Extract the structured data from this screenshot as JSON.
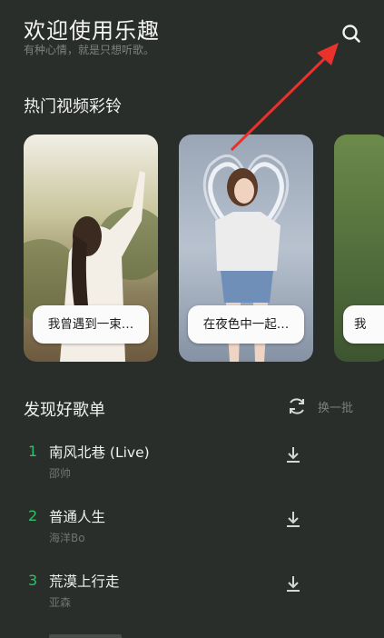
{
  "header": {
    "title": "欢迎使用乐趣",
    "subtitle": "有种心情，就是只想听歌。"
  },
  "video_section": {
    "title": "热门视频彩铃",
    "cards": [
      {
        "caption": "我曾遇到一束…"
      },
      {
        "caption": "在夜色中一起…"
      },
      {
        "caption": "我"
      }
    ]
  },
  "playlist_section": {
    "title": "发现好歌单",
    "refresh_label": "换一批",
    "songs": [
      {
        "index": "1",
        "title": "南风北巷 (Live)",
        "artist": "邵帅"
      },
      {
        "index": "2",
        "title": "普通人生",
        "artist": "海洋Bo"
      },
      {
        "index": "3",
        "title": "荒漠上行走",
        "artist": "亚森"
      }
    ]
  },
  "colors": {
    "background": "#2a2e2b",
    "accent_index": "#2fc06a",
    "annotation_arrow": "#e8322b"
  },
  "icons": [
    "search-icon",
    "refresh-icon",
    "download-icon"
  ]
}
